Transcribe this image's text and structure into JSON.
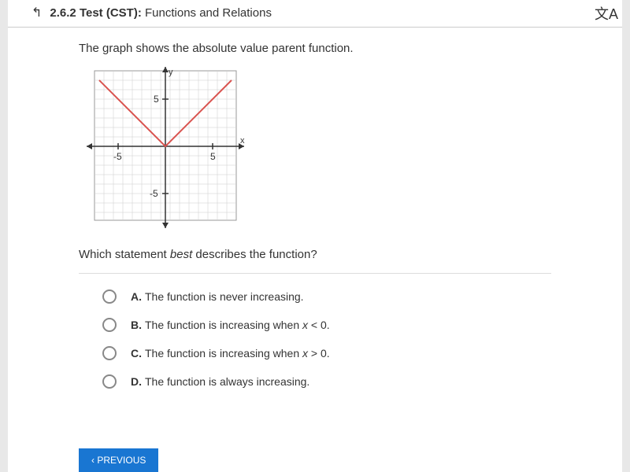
{
  "header": {
    "test_number": "2.6.2",
    "test_label": "Test (CST):",
    "subject": "Functions and Relations"
  },
  "question": {
    "intro": "The graph shows the absolute value parent function.",
    "sub_prefix": "Which statement ",
    "sub_italic": "best",
    "sub_suffix": " describes the function?"
  },
  "options": {
    "a": {
      "letter": "A.",
      "text": "The function is never increasing."
    },
    "b": {
      "letter": "B.",
      "prefix": "The function is increasing when ",
      "var": "x",
      "cond": " < 0."
    },
    "c": {
      "letter": "C.",
      "prefix": "The function is increasing when ",
      "var": "x",
      "cond": " > 0."
    },
    "d": {
      "letter": "D.",
      "text": "The function is always increasing."
    }
  },
  "button": {
    "previous": "PREVIOUS"
  },
  "chart_data": {
    "type": "line",
    "title": "",
    "xlabel": "x",
    "ylabel": "y",
    "xlim": [
      -8,
      8
    ],
    "ylim": [
      -8,
      8
    ],
    "x_ticks": [
      -5,
      5
    ],
    "y_ticks": [
      -5,
      5
    ],
    "series": [
      {
        "name": "absolute value",
        "color": "#d9534f",
        "points": [
          {
            "x": -7,
            "y": 7
          },
          {
            "x": 0,
            "y": 0
          },
          {
            "x": 7,
            "y": 7
          }
        ]
      }
    ]
  }
}
